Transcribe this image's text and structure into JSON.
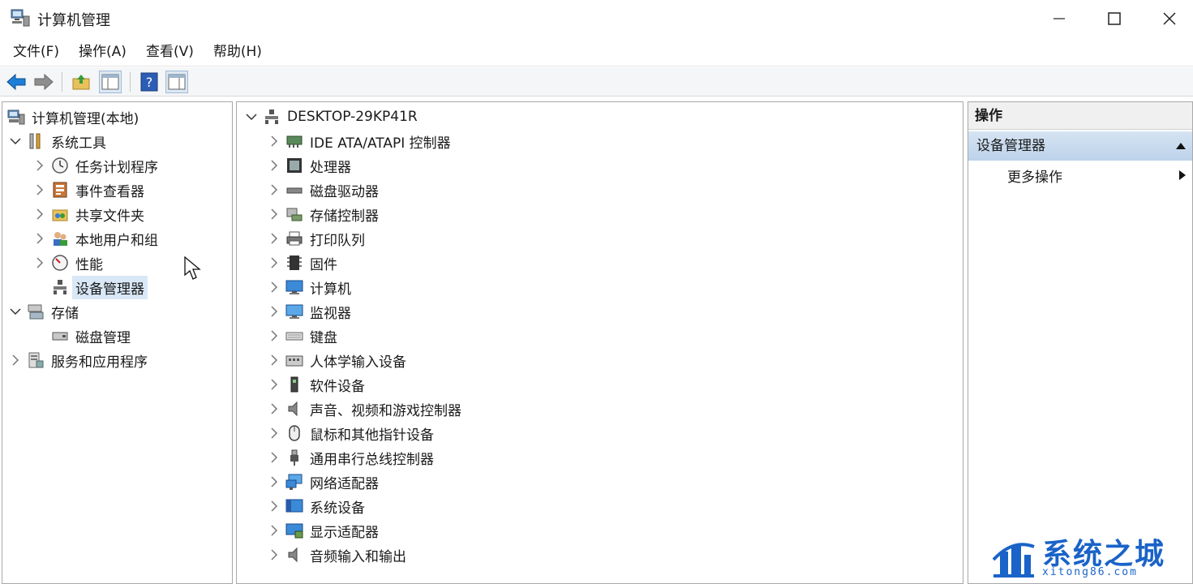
{
  "window": {
    "title": "计算机管理"
  },
  "menu": [
    "文件(F)",
    "操作(A)",
    "查看(V)",
    "帮助(H)"
  ],
  "left_tree": {
    "root": "计算机管理(本地)",
    "system_tools": "系统工具",
    "children": [
      "任务计划程序",
      "事件查看器",
      "共享文件夹",
      "本地用户和组",
      "性能",
      "设备管理器"
    ],
    "storage": "存储",
    "disk_management": "磁盘管理",
    "services": "服务和应用程序"
  },
  "device_tree": {
    "computer_name": "DESKTOP-29KP41R",
    "categories": [
      "IDE ATA/ATAPI 控制器",
      "处理器",
      "磁盘驱动器",
      "存储控制器",
      "打印队列",
      "固件",
      "计算机",
      "监视器",
      "键盘",
      "人体学输入设备",
      "软件设备",
      "声音、视频和游戏控制器",
      "鼠标和其他指针设备",
      "通用串行总线控制器",
      "网络适配器",
      "系统设备",
      "显示适配器",
      "音频输入和输出"
    ]
  },
  "actions": {
    "header": "操作",
    "section": "设备管理器",
    "more": "更多操作"
  },
  "watermark": {
    "text": "系统之城",
    "sub": "xitong86.com"
  },
  "colors": {
    "selection": "#d9e8f7",
    "brand": "#1a63c8",
    "arrow": "#1e7fd8"
  }
}
